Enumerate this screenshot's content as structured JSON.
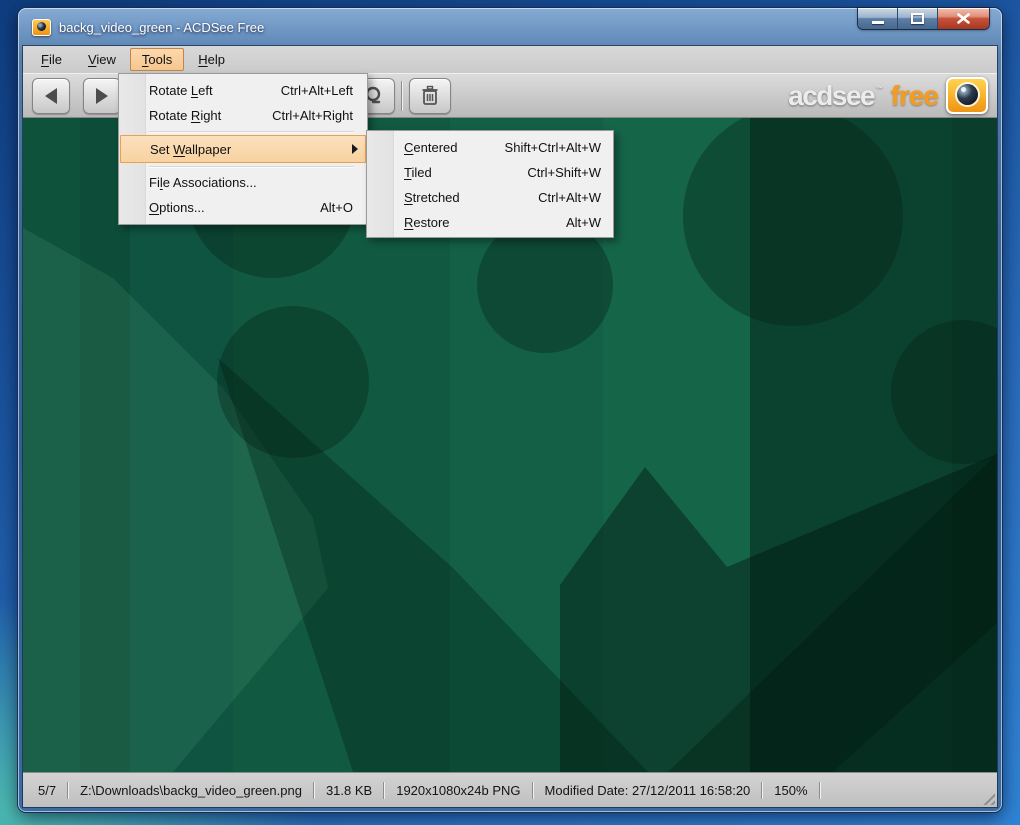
{
  "window": {
    "title": "backg_video_green - ACDSee Free"
  },
  "menubar": {
    "items": [
      {
        "pre": "",
        "key": "F",
        "post": "ile"
      },
      {
        "pre": "",
        "key": "V",
        "post": "iew"
      },
      {
        "pre": "",
        "key": "T",
        "post": "ools"
      },
      {
        "pre": "",
        "key": "H",
        "post": "elp"
      }
    ]
  },
  "menus": {
    "tools": {
      "items": [
        {
          "pre": "Rotate ",
          "key": "L",
          "post": "eft",
          "shortcut": "Ctrl+Alt+Left"
        },
        {
          "pre": "Rotate ",
          "key": "R",
          "post": "ight",
          "shortcut": "Ctrl+Alt+Right"
        },
        {
          "pre": "Set ",
          "key": "W",
          "post": "allpaper",
          "shortcut": "",
          "has_submenu": true,
          "highlighted": true
        },
        {
          "pre": "Fi",
          "key": "l",
          "post": "e Associations...",
          "shortcut": ""
        },
        {
          "pre": "",
          "key": "O",
          "post": "ptions...",
          "shortcut": "Alt+O"
        }
      ]
    },
    "wallpaper_submenu": {
      "items": [
        {
          "pre": "",
          "key": "C",
          "post": "entered",
          "shortcut": "Shift+Ctrl+Alt+W"
        },
        {
          "pre": "",
          "key": "T",
          "post": "iled",
          "shortcut": "Ctrl+Shift+W"
        },
        {
          "pre": "",
          "key": "S",
          "post": "tretched",
          "shortcut": "Ctrl+Alt+W"
        },
        {
          "pre": "",
          "key": "R",
          "post": "estore",
          "shortcut": "Alt+W"
        }
      ]
    }
  },
  "toolbar": {
    "icons": [
      "previous-icon",
      "next-icon",
      "zoom-icon",
      "delete-icon"
    ],
    "logo": {
      "brand": "acdsee",
      "tm": "™",
      "edition": "free"
    }
  },
  "statusbar": {
    "position": "5/7",
    "file_path": "Z:\\Downloads\\backg_video_green.png",
    "file_size": "31.8 KB",
    "dimensions": "1920x1080x24b PNG",
    "modified": "Modified Date: 27/12/2011 16:58:20",
    "zoom_level": "150%"
  },
  "colors": {
    "accent_orange": "#f59b1e",
    "menu_highlight": "#f8d2a0",
    "aero_blue": "#2f5d94",
    "wallpaper_base": "#115a41"
  }
}
